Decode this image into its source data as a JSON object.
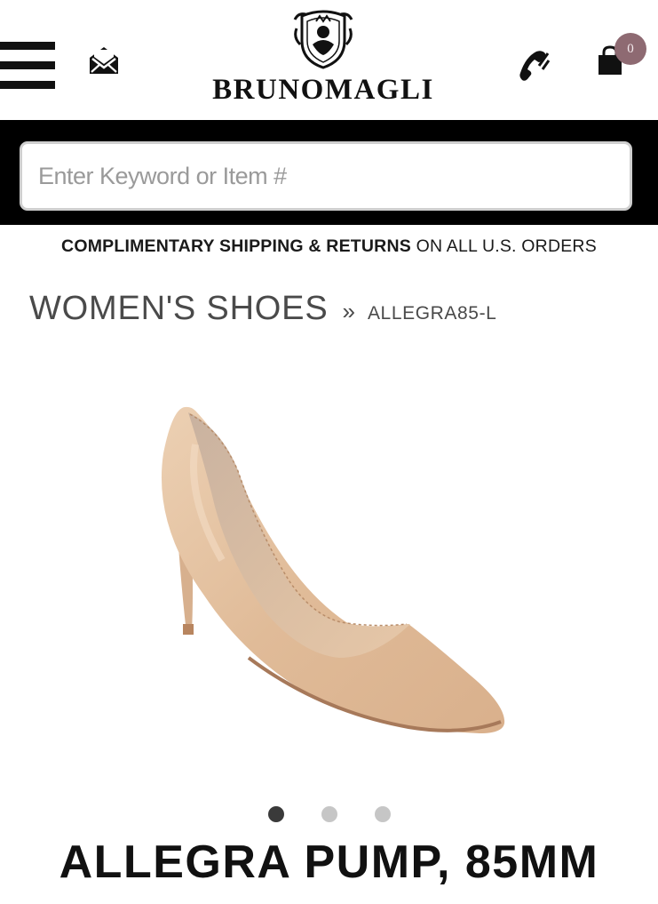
{
  "header": {
    "brand_name": "BRUNOMAGLI",
    "cart_count": "0",
    "icons": {
      "menu": "hamburger-menu-icon",
      "mail": "envelope-icon",
      "phone": "phone-icon",
      "cart": "shopping-bag-icon"
    }
  },
  "search": {
    "placeholder": "Enter Keyword or Item #",
    "value": ""
  },
  "promo": {
    "bold_text": "COMPLIMENTARY SHIPPING & RETURNS",
    "rest_text": " ON ALL U.S. ORDERS"
  },
  "breadcrumb": {
    "category": "WOMEN'S SHOES",
    "separator": "»",
    "current": "ALLEGRA85-L"
  },
  "carousel": {
    "total_slides": 3,
    "active_index": 0
  },
  "product": {
    "title": "ALLEGRA PUMP, 85MM"
  },
  "colors": {
    "header_band": "#000000",
    "badge": "#8e6a72",
    "shoe": "#e2bf9f",
    "dot_active": "#3a3a3a",
    "dot_inactive": "#c6c6c6"
  }
}
